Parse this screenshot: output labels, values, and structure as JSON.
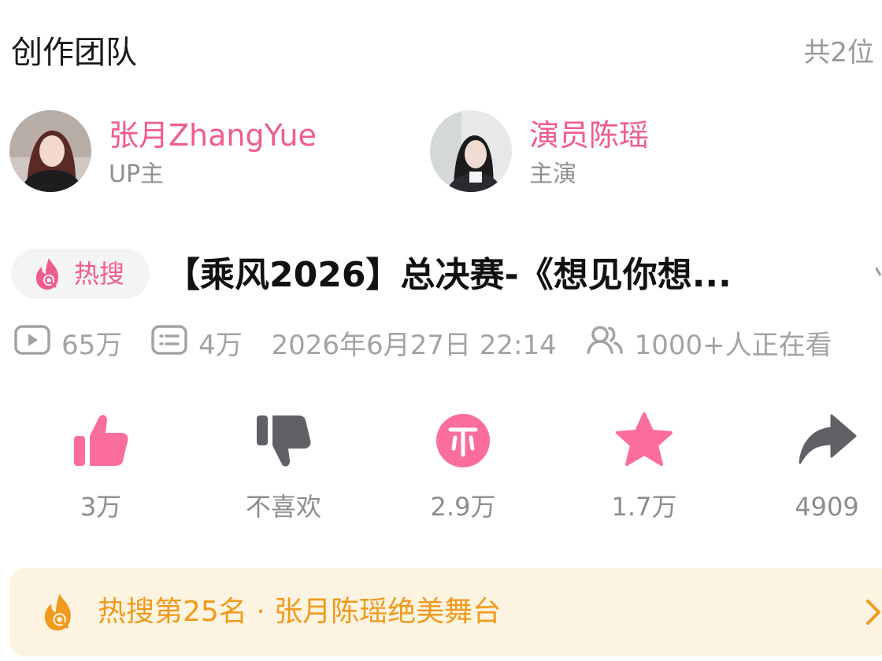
{
  "team": {
    "title": "创作团队",
    "count": "共2位",
    "members": [
      {
        "name": "张月ZhangYue",
        "role": "UP主",
        "avatar": "avatar-photo"
      },
      {
        "name": "演员陈瑶",
        "role": "主演",
        "avatar": "avatar-photo"
      }
    ]
  },
  "video": {
    "hot_badge": "热搜",
    "title": "【乘风2026】总决赛-《想见你想..."
  },
  "stats": {
    "plays": "65万",
    "danmaku": "4万",
    "datetime": "2026年6月27日 22:14",
    "watching": "1000+人正在看"
  },
  "actions": [
    {
      "name": "like",
      "icon": "thumbs-up-icon",
      "count": "3万",
      "color": "#fb6d9c"
    },
    {
      "name": "dislike",
      "icon": "thumbs-down-icon",
      "count": "不喜欢",
      "color": "#5f6166"
    },
    {
      "name": "coin",
      "icon": "coin-icon",
      "count": "2.9万",
      "color": "#fb6d9c"
    },
    {
      "name": "favorite",
      "icon": "star-icon",
      "count": "1.7万",
      "color": "#fb6d9c"
    },
    {
      "name": "share",
      "icon": "share-icon",
      "count": "4909",
      "color": "#5f6166"
    }
  ],
  "hot_banner": {
    "text": "热搜第25名 · 张月陈瑶绝美舞台",
    "color": "#f09a1d"
  },
  "colors": {
    "accent": "#f15c8e",
    "muted": "#9a9a9a",
    "banner_bg": "#fdf3e1"
  }
}
